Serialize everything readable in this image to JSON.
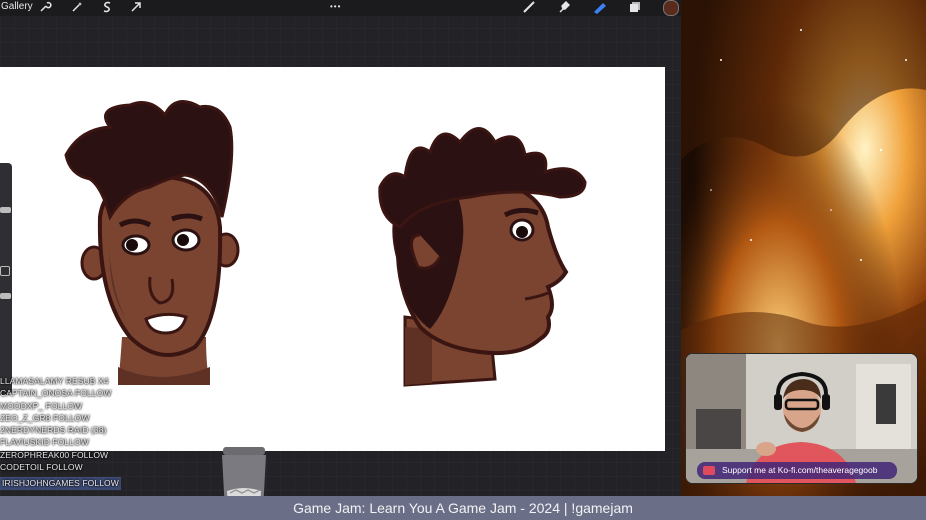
{
  "app": {
    "gallery_label": "Gallery",
    "top_dots": "•••",
    "icons_left": [
      "wrench-icon",
      "magic-wand-icon",
      "selection-s-icon",
      "transform-arrow-icon"
    ],
    "icons_right": [
      "brush-icon",
      "smudge-icon",
      "eraser-icon",
      "layers-icon",
      "color-swatch-icon"
    ],
    "active_color": "#5a2a1c"
  },
  "chat": {
    "lines": [
      "LLAMASALAMY  RESUB X4",
      "CAPTAIN_ONOSA  FOLLOW",
      "MOODXP_  FOLLOW",
      "ZEO_Z_GR8  FOLLOW",
      "2NERDYNERDS  RAID (38)",
      "FLAVIUSKID  FOLLOW",
      "ZEROPHREAK00  FOLLOW",
      "CODETOIL  FOLLOW",
      "IRISHJOHNGAMES  FOLLOW"
    ]
  },
  "kofi": {
    "text": "Support me at Ko-fi.com/theaveragegoob"
  },
  "stream_title": "Game Jam: Learn You A Game Jam - 2024 | !gamejam",
  "colors": {
    "skin": "#7a4431",
    "skin_shade": "#5e3124",
    "hair": "#2b1112",
    "outline": "#3a1512",
    "bar": "#6a6f87"
  }
}
